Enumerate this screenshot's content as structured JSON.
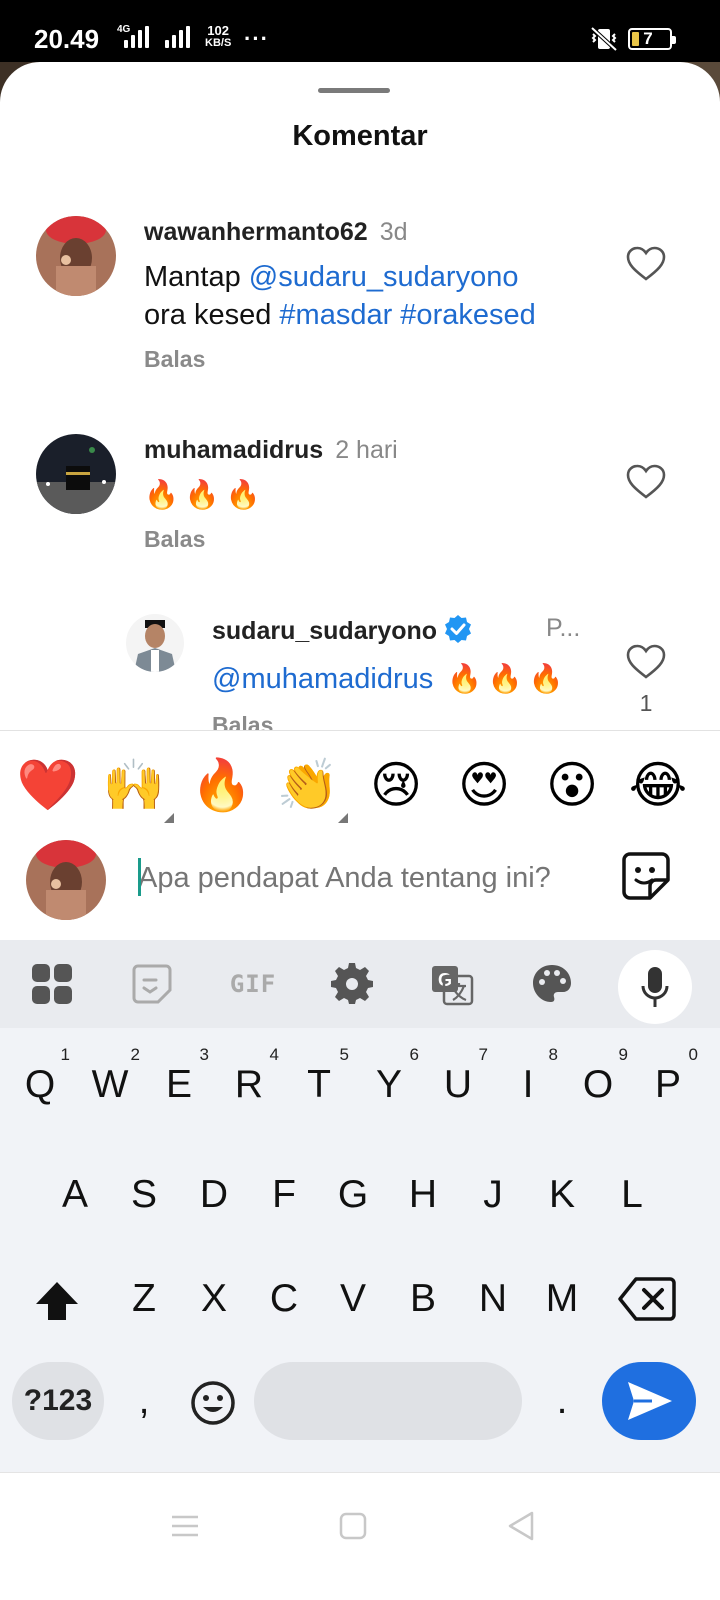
{
  "status_bar": {
    "time": "20.49",
    "network": "4G",
    "speed_value": "102",
    "speed_unit": "KB/S",
    "more": "···",
    "battery": "7"
  },
  "sheet": {
    "title": "Komentar"
  },
  "comments": [
    {
      "username": "wawanhermanto62",
      "time": "3d",
      "text_line1_prefix": "Mantap ",
      "text_line1_mention": "@sudaru_sudaryono",
      "text_line2_prefix": "ora kesed ",
      "text_line2_tags": "#masdar #orakesed",
      "reply_label": "Balas"
    },
    {
      "username": "muhamadidrus",
      "time": "2 hari",
      "text": "🔥🔥🔥",
      "reply_label": "Balas"
    },
    {
      "username": "sudaru_sudaryono",
      "time": "P...",
      "mention": "@muhamadidrus",
      "text": " 🔥🔥🔥",
      "reply_label": "Balas",
      "like_count": "1",
      "verified": true
    }
  ],
  "reactions": [
    "❤️",
    "🙌",
    "🔥",
    "👏",
    "😢",
    "😍",
    "😮",
    "😂"
  ],
  "composer": {
    "placeholder": "Apa pendapat Anda tentang ini?"
  },
  "keyboard": {
    "toolbar": [
      "apps-icon",
      "clipboard-sticker-icon",
      "gif-icon",
      "settings-icon",
      "translate-icon",
      "theme-icon",
      "mic-icon"
    ],
    "gif_label": "GIF",
    "row1": [
      {
        "key": "Q",
        "hint": "1"
      },
      {
        "key": "W",
        "hint": "2"
      },
      {
        "key": "E",
        "hint": "3"
      },
      {
        "key": "R",
        "hint": "4"
      },
      {
        "key": "T",
        "hint": "5"
      },
      {
        "key": "Y",
        "hint": "6"
      },
      {
        "key": "U",
        "hint": "7"
      },
      {
        "key": "I",
        "hint": "8"
      },
      {
        "key": "O",
        "hint": "9"
      },
      {
        "key": "P",
        "hint": "0"
      }
    ],
    "row2": [
      "A",
      "S",
      "D",
      "F",
      "G",
      "H",
      "J",
      "K",
      "L"
    ],
    "row3": [
      "Z",
      "X",
      "C",
      "V",
      "B",
      "N",
      "M"
    ],
    "symbols_label": "?123",
    "comma": ",",
    "period": "."
  },
  "colors": {
    "mention": "#1e6bd0",
    "send_button": "#1f6fe0",
    "caret": "#1a9b8b"
  }
}
